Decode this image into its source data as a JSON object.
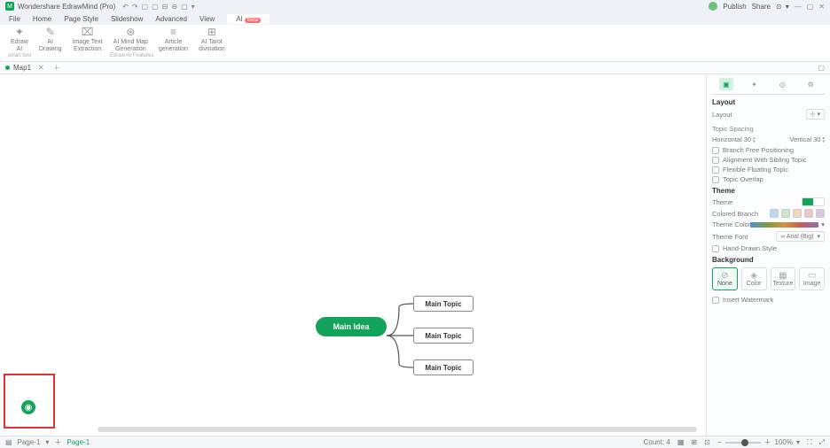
{
  "titlebar": {
    "app_name": "Wondershare EdrawMind (Pro)",
    "publish": "Publish",
    "share": "Share"
  },
  "menubar": {
    "tabs": [
      "File",
      "Home",
      "Page Style",
      "Slideshow",
      "Advanced",
      "View"
    ],
    "ai_tab": "AI",
    "ai_badge": "Beta"
  },
  "ribbon": {
    "items": [
      {
        "label_1": "Edraw",
        "label_2": "AI"
      },
      {
        "label_1": "AI",
        "label_2": "Drawing"
      },
      {
        "label_1": "Image Text",
        "label_2": "Extraction"
      },
      {
        "label_1": "AI Mind Map",
        "label_2": "Generation"
      },
      {
        "label_1": "Article",
        "label_2": "generation"
      },
      {
        "label_1": "AI Tarot",
        "label_2": "divination"
      }
    ],
    "group1": "smart tool",
    "group2": "Edraw AI Features"
  },
  "tabstrip": {
    "doc_name": "Map1"
  },
  "mindmap": {
    "main": "Main Idea",
    "topics": [
      "Main Topic",
      "Main Topic",
      "Main Topic"
    ]
  },
  "sidepanel": {
    "section_layout": "Layout",
    "layout_label": "Layout",
    "spacing_label": "Topic Spacing",
    "horizontal": "Horizontal",
    "horizontal_val": "30",
    "vertical": "Vertical",
    "vertical_val": "30",
    "checks": [
      "Branch Free Positioning",
      "Alignment With Sibling Topic",
      "Flexible Floating Topic",
      "Topic Overlap"
    ],
    "section_theme": "Theme",
    "theme_label": "Theme",
    "colored_branch": "Colored Branch",
    "theme_color": "Theme Color",
    "theme_font": "Theme Font",
    "theme_font_val": "∞ Arial (Big)",
    "hand_drawn": "Hand-Drawn Style",
    "section_bg": "Background",
    "bg_opts": [
      "None",
      "Color",
      "Texture",
      "Image"
    ],
    "insert_wm": "Insert Watermark"
  },
  "statusbar": {
    "page_name": "Page-1",
    "page_label": "Page-1",
    "count": "Count: 4",
    "zoom": "100%"
  }
}
